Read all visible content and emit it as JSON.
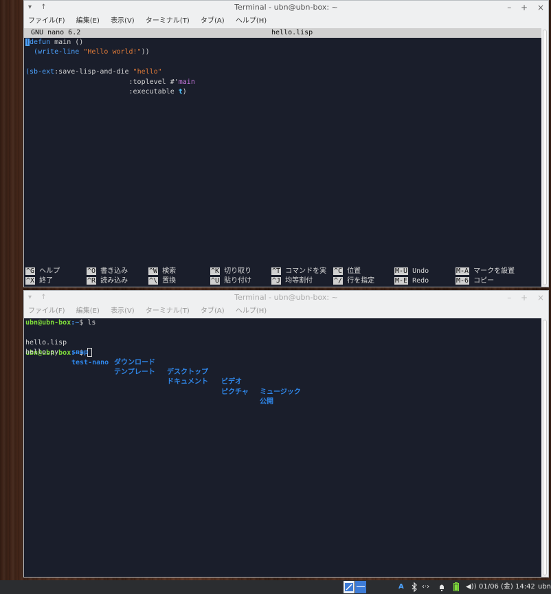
{
  "top_window": {
    "title": "Terminal - ubn@ubn-box: ~",
    "title_left_buttons": [
      "▾",
      "↑"
    ],
    "title_right_buttons": [
      "–",
      "+",
      "×"
    ],
    "menu": [
      "ファイル(F)",
      "編集(E)",
      "表示(V)",
      "ターミナル(T)",
      "タブ(A)",
      "ヘルプ(H)"
    ],
    "nano": {
      "version": "GNU nano 6.2",
      "filename": "hello.lisp",
      "code": {
        "l1_open": "(",
        "l1_kw": "defun",
        "l1_rest": " main ()",
        "l2_indent": "  (",
        "l2_kw": "write-line",
        "l2_str": "\"Hello world!\"",
        "l2_close": "))",
        "l4_open": "(",
        "l4_kw": "sb-ext",
        "l4_rest": ":save-lisp-and-die ",
        "l4_str": "\"hello\"",
        "l5_pre": "                         :toplevel #'",
        "l5_main": "main",
        "l6_pre": "                         :executable ",
        "l6_t": "t",
        "l6_close": ")"
      },
      "shortcuts_row1": [
        {
          "key": "^G",
          "label": "ヘルプ"
        },
        {
          "key": "^O",
          "label": "書き込み"
        },
        {
          "key": "^W",
          "label": "検索"
        },
        {
          "key": "^K",
          "label": "切り取り"
        },
        {
          "key": "^T",
          "label": "コマンドを実"
        },
        {
          "key": "^C",
          "label": "位置"
        },
        {
          "key": "M-U",
          "label": "Undo"
        },
        {
          "key": "M-A",
          "label": "マークを設置"
        }
      ],
      "shortcuts_row2": [
        {
          "key": "^X",
          "label": "終了"
        },
        {
          "key": "^R",
          "label": "読み込み"
        },
        {
          "key": "^\\",
          "label": "置換"
        },
        {
          "key": "^U",
          "label": "貼り付け"
        },
        {
          "key": "^J",
          "label": "均等割付"
        },
        {
          "key": "^/",
          "label": "行を指定"
        },
        {
          "key": "M-E",
          "label": "Redo"
        },
        {
          "key": "M-6",
          "label": "コピー"
        }
      ]
    }
  },
  "bottom_window": {
    "title": "Terminal - ubn@ubn-box: ~",
    "title_left_buttons": [
      "▾",
      "↑"
    ],
    "title_right_buttons": [
      "–",
      "+",
      "×"
    ],
    "menu": [
      "ファイル(F)",
      "編集(E)",
      "表示(V)",
      "ターミナル(T)",
      "タブ(A)",
      "ヘルプ(H)"
    ],
    "prompt_user": "ubn@ubn-box",
    "prompt_path": ":~",
    "prompt_symbol": "$ ",
    "command": "ls",
    "ls_row1": [
      {
        "name": "hello.lisp",
        "type": "file"
      },
      {
        "name": "snap",
        "type": "dir"
      },
      {
        "name": "ダウンロード",
        "type": "dir"
      },
      {
        "name": "デスクトップ",
        "type": "dir"
      },
      {
        "name": "ビデオ",
        "type": "dir"
      },
      {
        "name": "ミュージック",
        "type": "dir"
      }
    ],
    "ls_row2": [
      {
        "name": "hello.py",
        "type": "file"
      },
      {
        "name": "test-nano",
        "type": "dir"
      },
      {
        "name": "テンプレート",
        "type": "dir"
      },
      {
        "name": "ドキュメント",
        "type": "dir"
      },
      {
        "name": "ピクチャ",
        "type": "dir"
      },
      {
        "name": "公開",
        "type": "dir"
      }
    ]
  },
  "taskbar": {
    "keyboard_indicator": "A",
    "bluetooth_icon": "bluetooth-icon",
    "network_icon": "network-icon",
    "notification_icon": "bell-icon",
    "battery_icon": "battery-icon",
    "volume_icon": "volume-icon",
    "clock": "01/06 (金) 14:42",
    "user": "ubn",
    "accent": "#3d7bd6"
  }
}
